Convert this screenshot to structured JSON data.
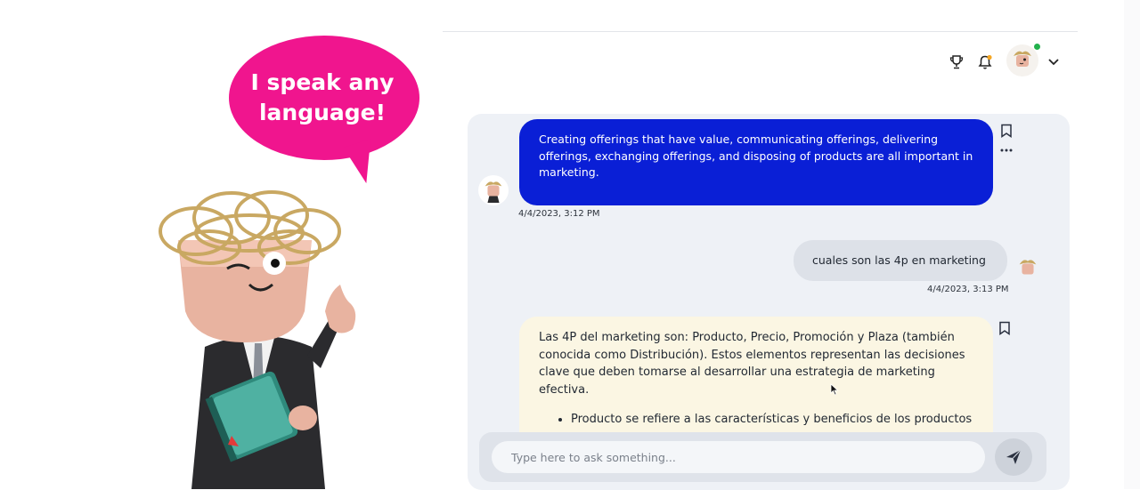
{
  "promo": {
    "bubble_text": "I speak any language!",
    "bubble_color": "#f0158e"
  },
  "header": {
    "icons": [
      "trophy-icon",
      "bell-icon",
      "user-avatar",
      "chevron-down-icon"
    ],
    "notification_dot_color": "#f5a623",
    "online_color": "#22b14c"
  },
  "chat": {
    "messages": [
      {
        "sender": "bot",
        "text": "Creating offerings that have value, communicating offerings, delivering offerings, exchanging offerings, and disposing of products are all important in marketing.",
        "timestamp": "4/4/2023, 3:12 PM",
        "color": "#0a1fd6"
      },
      {
        "sender": "user",
        "text": "cuales son las 4p en marketing",
        "timestamp": "4/4/2023, 3:13 PM"
      },
      {
        "sender": "bot",
        "text": "Las 4P del marketing son: Producto, Precio, Promoción y Plaza (también conocida como Distribución). Estos elementos representan las decisiones clave que deben tomarse al desarrollar una estrategia de marketing efectiva.",
        "bullet": "Producto se refiere a las características y beneficios de los productos"
      }
    ]
  },
  "input": {
    "placeholder": "Type here to ask something..."
  }
}
